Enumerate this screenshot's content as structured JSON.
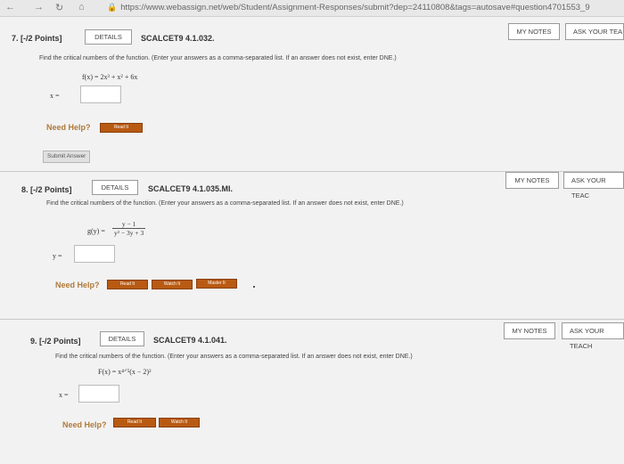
{
  "browser": {
    "url": "https://www.webassign.net/web/Student/Assignment-Responses/submit?dep=24110808&tags=autosave#question4701553_9"
  },
  "questions": [
    {
      "number": "7.",
      "points": "[-/2 Points]",
      "details_label": "DETAILS",
      "code": "SCALCET9 4.1.032.",
      "my_notes": "MY NOTES",
      "ask_teacher": "ASK YOUR TEA",
      "prompt": "Find the critical numbers of the function. (Enter your answers as a comma-separated list. If an answer does not exist, enter DNE.)",
      "function": "f(x) = 2x³ + x² + 6x",
      "variable": "x =",
      "answer_value": "",
      "need_help": "Need Help?",
      "help_buttons": [
        "Read It"
      ],
      "submit_label": "Submit Answer"
    },
    {
      "number": "8.",
      "points": "[-/2 Points]",
      "details_label": "DETAILS",
      "code": "SCALCET9 4.1.035.MI.",
      "my_notes": "MY NOTES",
      "ask_teacher": "ASK YOUR TEAC",
      "prompt": "Find the critical numbers of the function. (Enter your answers as a comma-separated list. If an answer does not exist, enter DNE.)",
      "function_name": "g(y) =",
      "function_num": "y − 1",
      "function_den": "y² − 3y + 3",
      "variable": "y =",
      "answer_value": "",
      "need_help": "Need Help?",
      "help_buttons": [
        "Read It",
        "Watch It",
        "Master It"
      ]
    },
    {
      "number": "9.",
      "points": "[-/2 Points]",
      "details_label": "DETAILS",
      "code": "SCALCET9 4.1.041.",
      "my_notes": "MY NOTES",
      "ask_teacher": "ASK YOUR TEACH",
      "prompt": "Find the critical numbers of the function. (Enter your answers as a comma-separated list. If an answer does not exist, enter DNE.)",
      "function": "F(x) = x⁴ᐟ⁵(x − 2)²",
      "variable": "x =",
      "answer_value": "",
      "need_help": "Need Help?",
      "help_buttons": [
        "Read It",
        "Watch It"
      ]
    }
  ]
}
